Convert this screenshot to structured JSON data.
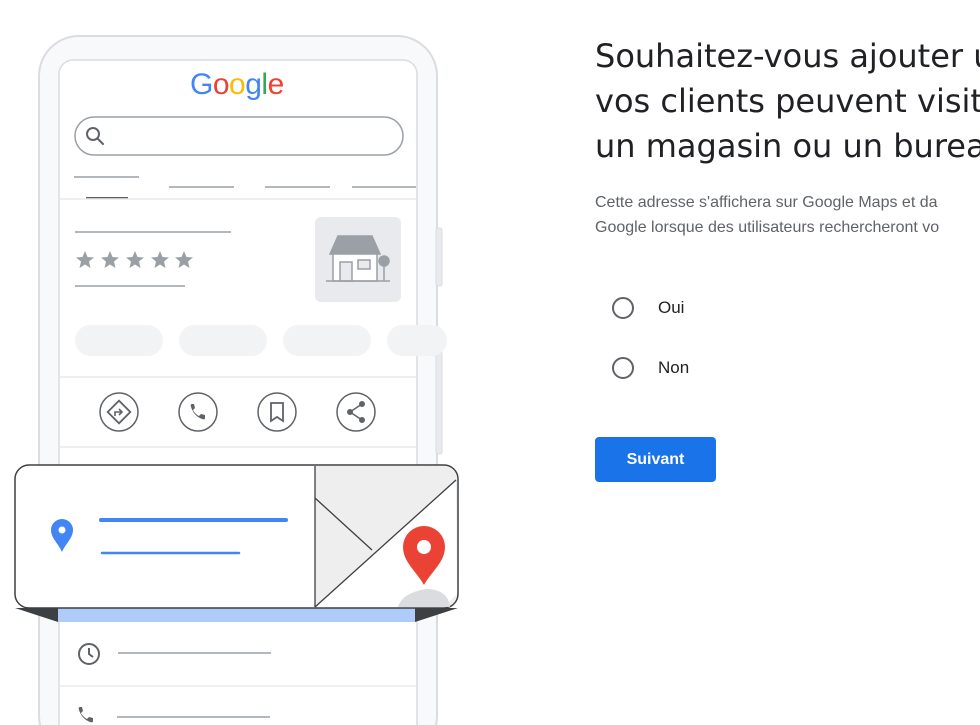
{
  "illustration": {
    "logo_text": "Google",
    "logo_colors": [
      "#4285F4",
      "#EA4335",
      "#FBBC05",
      "#4285F4",
      "#34A853",
      "#EA4335"
    ]
  },
  "question": {
    "title_lines": [
      "Souhaitez-vous ajouter u",
      "vos clients peuvent visite",
      "un magasin ou un bureau"
    ],
    "subtitle_lines": [
      "Cette adresse s'affichera sur Google Maps et da",
      "Google lorsque des utilisateurs rechercheront vo"
    ]
  },
  "options": [
    {
      "label": "Oui",
      "selected": false
    },
    {
      "label": "Non",
      "selected": false
    }
  ],
  "next_button": {
    "label": "Suivant"
  },
  "colors": {
    "accent": "#1a73e8",
    "pin_blue": "#4285F4",
    "pin_red": "#EA4335",
    "card_band": "#aecbfa"
  }
}
